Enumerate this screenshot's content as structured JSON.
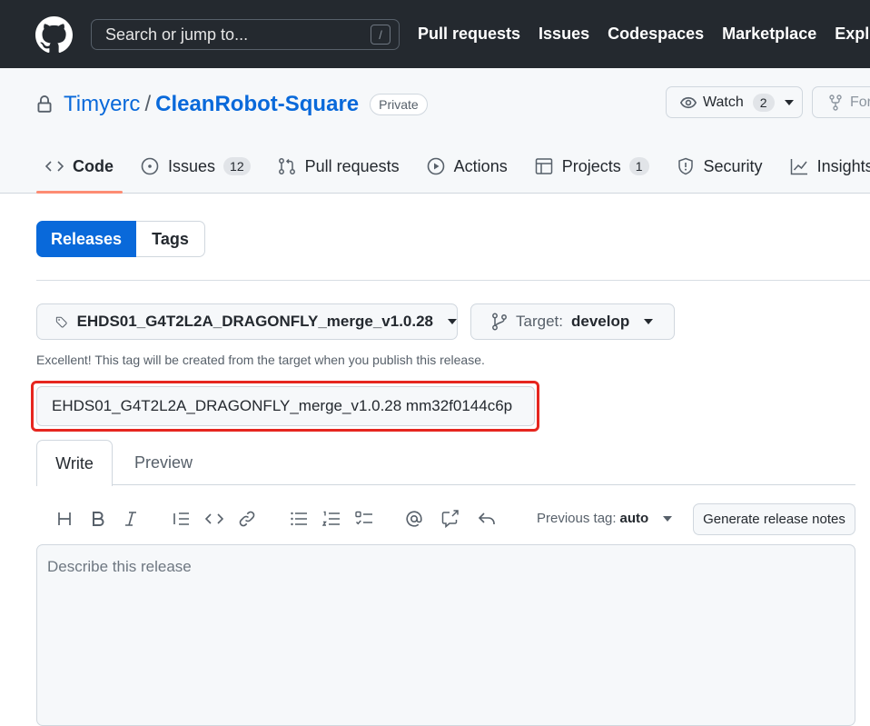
{
  "header": {
    "search_placeholder": "Search or jump to...",
    "slash_key": "/",
    "nav": [
      "Pull requests",
      "Issues",
      "Codespaces",
      "Marketplace",
      "Explore"
    ]
  },
  "repo": {
    "owner": "Timyerc",
    "separator": "/",
    "name": "CleanRobot-Square",
    "visibility": "Private",
    "watch_label": "Watch",
    "watch_count": "2",
    "fork_label": "Fork"
  },
  "tabs": [
    {
      "label": "Code",
      "icon": "code-icon",
      "active": true
    },
    {
      "label": "Issues",
      "icon": "issue-icon",
      "count": "12"
    },
    {
      "label": "Pull requests",
      "icon": "pull-request-icon"
    },
    {
      "label": "Actions",
      "icon": "play-icon"
    },
    {
      "label": "Projects",
      "icon": "table-icon",
      "count": "1"
    },
    {
      "label": "Security",
      "icon": "shield-icon"
    },
    {
      "label": "Insights",
      "icon": "graph-icon"
    }
  ],
  "release_tabs": {
    "releases": "Releases",
    "tags": "Tags"
  },
  "release_form": {
    "tag": "EHDS01_G4T2L2A_DRAGONFLY_merge_v1.0.28",
    "target_label": "Target:",
    "target_value": "develop",
    "hint": "Excellent! This tag will be created from the target when you publish this release.",
    "title_value": "EHDS01_G4T2L2A_DRAGONFLY_merge_v1.0.28 mm32f0144c6p",
    "write_tab": "Write",
    "preview_tab": "Preview",
    "previous_tag_label": "Previous tag:",
    "previous_tag_value": "auto",
    "generate_button": "Generate release notes",
    "description_placeholder": "Describe this release"
  },
  "colors": {
    "header_bg": "#24292f",
    "link": "#0969da",
    "primary_button": "#0969da",
    "active_tab_underline": "#fd8c73",
    "highlight_box": "#e6261f"
  }
}
